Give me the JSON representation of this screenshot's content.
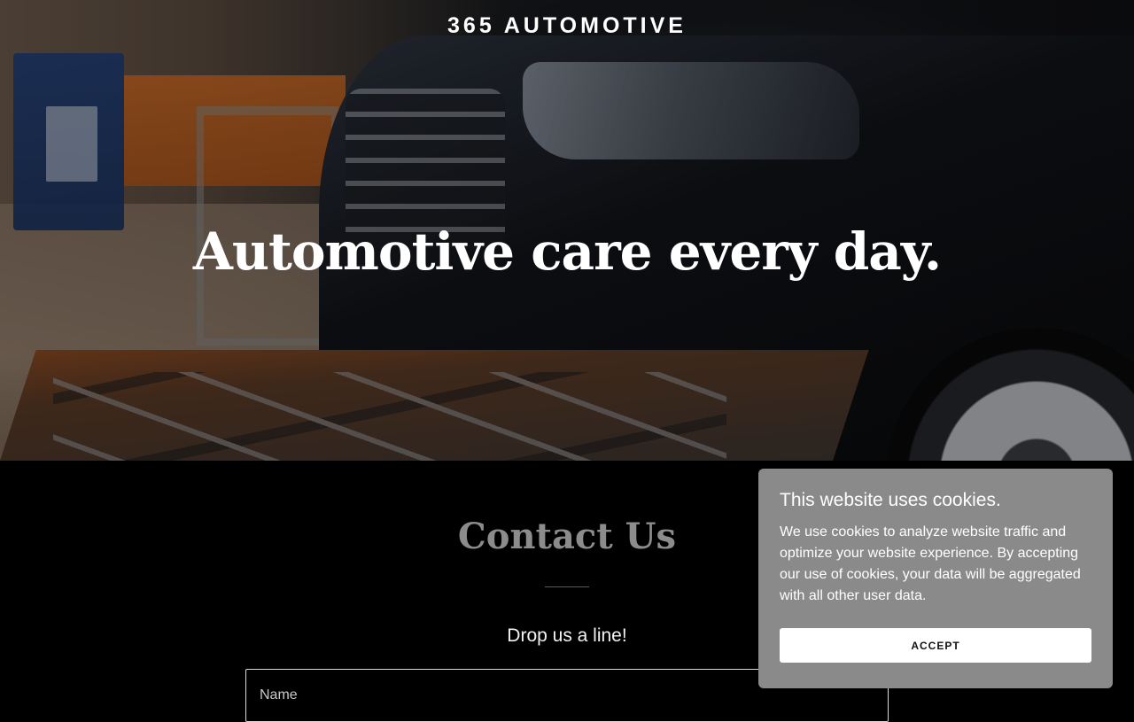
{
  "header": {
    "brand": "365 AUTOMOTIVE"
  },
  "hero": {
    "headline": "Automotive care every day."
  },
  "contact": {
    "title": "Contact Us",
    "subtitle": "Drop us a line!",
    "name_placeholder": "Name"
  },
  "cookie_banner": {
    "title": "This website uses cookies.",
    "text": "We use cookies to analyze website traffic and optimize your website experience. By accepting our use of cookies, your data will be aggregated with all other user data.",
    "accept_label": "ACCEPT"
  }
}
